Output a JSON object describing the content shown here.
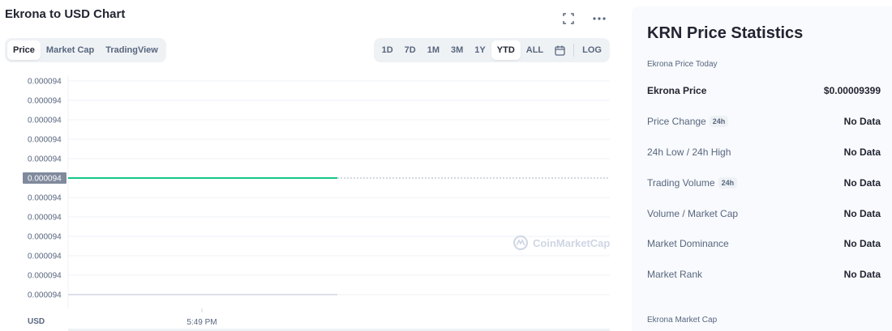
{
  "header": {
    "title": "Ekrona to USD Chart"
  },
  "view_tabs": [
    {
      "label": "Price",
      "active": true
    },
    {
      "label": "Market Cap",
      "active": false
    },
    {
      "label": "TradingView",
      "active": false
    }
  ],
  "range_tabs": [
    {
      "label": "1D",
      "active": false
    },
    {
      "label": "7D",
      "active": false
    },
    {
      "label": "1M",
      "active": false
    },
    {
      "label": "3M",
      "active": false
    },
    {
      "label": "1Y",
      "active": false
    },
    {
      "label": "YTD",
      "active": true
    },
    {
      "label": "ALL",
      "active": false
    }
  ],
  "log_label": "LOG",
  "icons": {
    "fullscreen": "fullscreen-icon",
    "more": "more-icon",
    "calendar": "calendar-icon",
    "watermark": "coinmarketcap-logo-icon"
  },
  "colors": {
    "line": "#16c784",
    "current_price_tag_bg": "#808a9d",
    "grid": "#eff2f5",
    "axis_text": "#58667e"
  },
  "chart_data": {
    "type": "line",
    "x": [
      "5:49 PM"
    ],
    "x_tick_labels": [
      "5:49 PM"
    ],
    "series": [
      {
        "values": [
          9.4e-05
        ]
      }
    ],
    "y_tick_labels": [
      "0.000094",
      "0.000094",
      "0.000094",
      "0.000094",
      "0.000094",
      "0.000094",
      "0.000094",
      "0.000094",
      "0.000094",
      "0.000094",
      "0.000094",
      "0.000094"
    ],
    "current_price_label": "0.000094",
    "ylabel": "USD",
    "watermark": "CoinMarketCap",
    "grid": true
  },
  "stats": {
    "title": "KRN Price Statistics",
    "subtitle": "Ekrona Price Today",
    "rows": [
      {
        "label": "Ekrona Price",
        "value": "$0.00009399",
        "badge": ""
      },
      {
        "label": "Price Change",
        "value": "No Data",
        "badge": "24h"
      },
      {
        "label": "24h Low / 24h High",
        "value": "No Data",
        "badge": ""
      },
      {
        "label": "Trading Volume",
        "value": "No Data",
        "badge": "24h"
      },
      {
        "label": "Volume / Market Cap",
        "value": "No Data",
        "badge": ""
      },
      {
        "label": "Market Dominance",
        "value": "No Data",
        "badge": ""
      },
      {
        "label": "Market Rank",
        "value": "No Data",
        "badge": ""
      }
    ],
    "footer": "Ekrona Market Cap"
  }
}
